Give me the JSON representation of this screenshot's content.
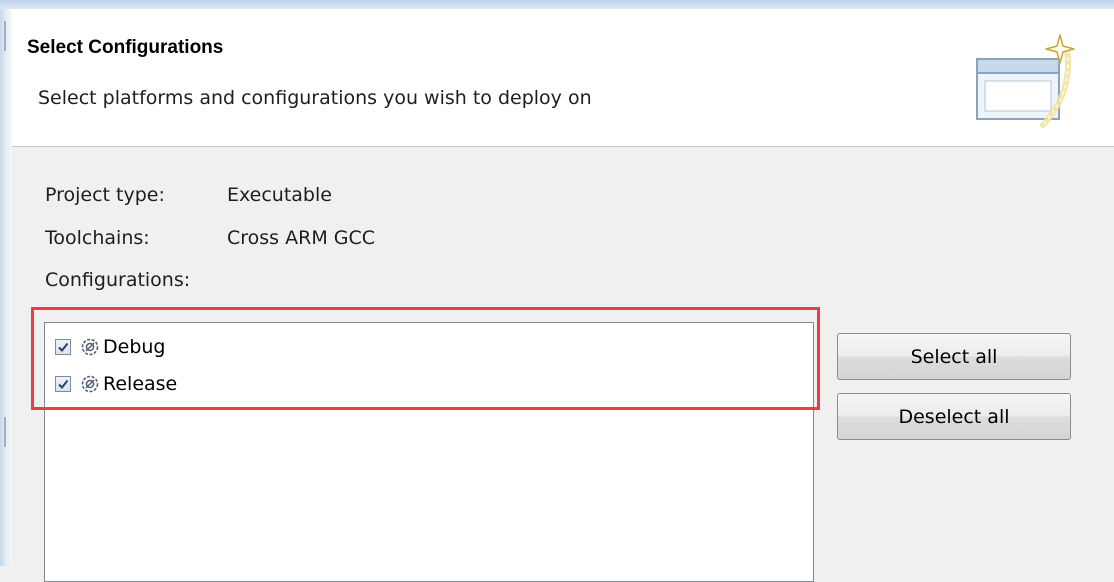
{
  "header": {
    "title": "Select Configurations",
    "description": "Select platforms and configurations you wish to deploy on",
    "icon": "wizard-banner-icon"
  },
  "info": {
    "project_type_label": "Project type:",
    "project_type_value": "Executable",
    "toolchains_label": "Toolchains:",
    "toolchains_value": "Cross ARM GCC",
    "configurations_label": "Configurations:"
  },
  "configurations": [
    {
      "label": "Debug",
      "checked": true,
      "icon": "configuration-gear-icon"
    },
    {
      "label": "Release",
      "checked": true,
      "icon": "configuration-gear-icon"
    }
  ],
  "buttons": {
    "select_all": "Select all",
    "deselect_all": "Deselect all"
  },
  "colors": {
    "highlight": "#ee3b45",
    "checkmark": "#2f3f6b",
    "list_border": "#828790"
  }
}
